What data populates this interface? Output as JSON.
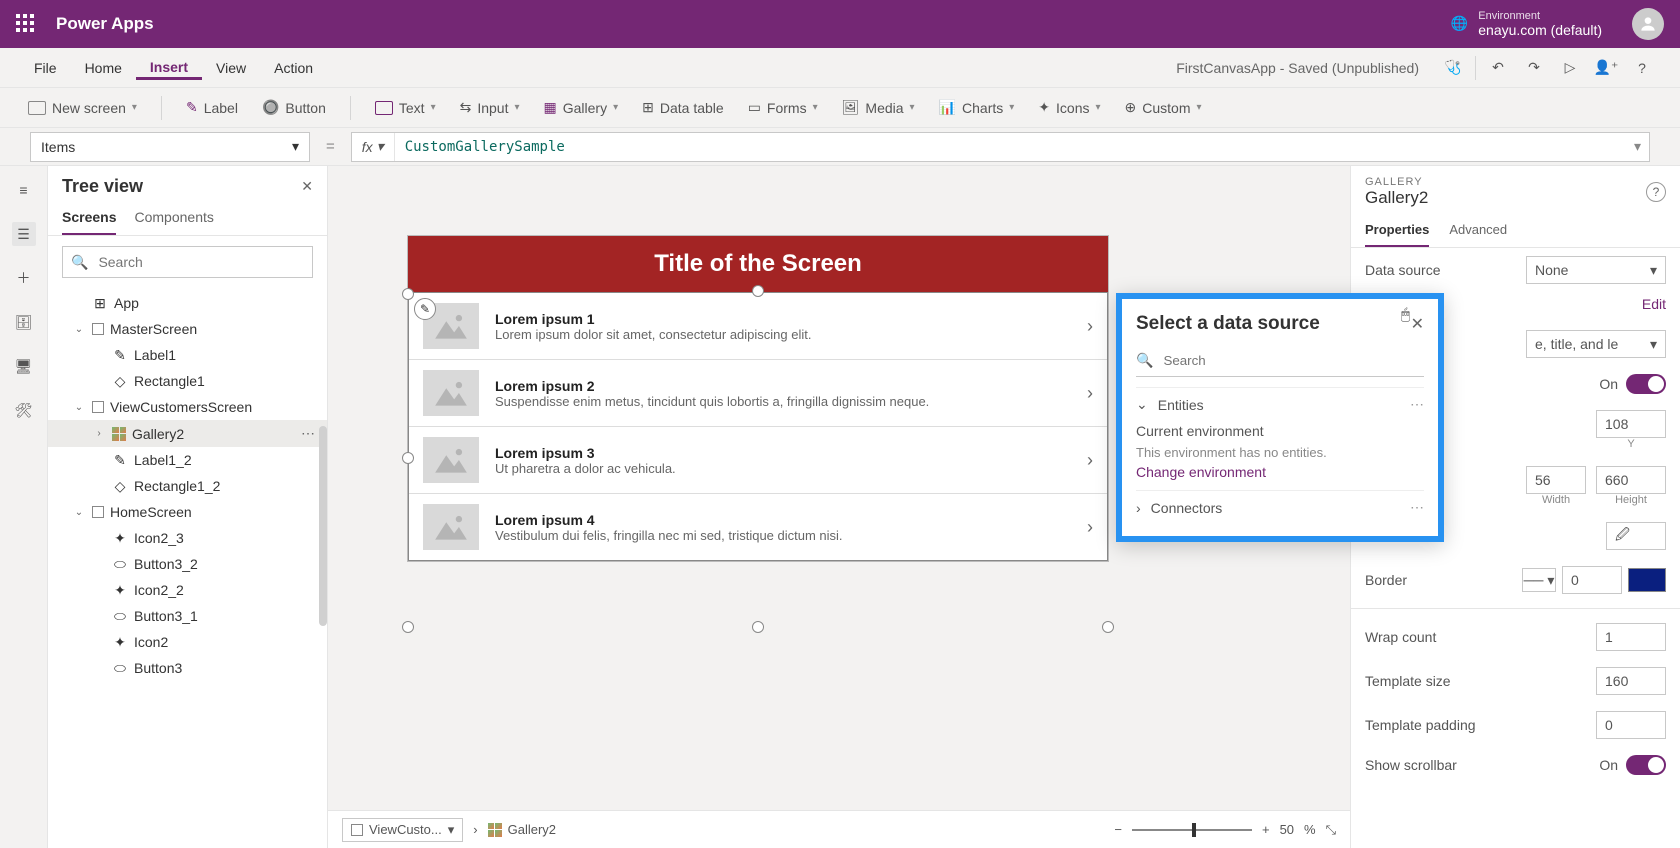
{
  "top": {
    "app": "Power Apps",
    "env_label": "Environment",
    "env_name": "enayu.com (default)"
  },
  "menu": {
    "items": [
      "File",
      "Home",
      "Insert",
      "View",
      "Action"
    ],
    "active": "Insert",
    "doc_title": "FirstCanvasApp - Saved (Unpublished)"
  },
  "insert": {
    "new_screen": "New screen",
    "label": "Label",
    "button": "Button",
    "text": "Text",
    "input": "Input",
    "gallery": "Gallery",
    "data_table": "Data table",
    "forms": "Forms",
    "media": "Media",
    "charts": "Charts",
    "icons": "Icons",
    "custom": "Custom"
  },
  "formula": {
    "prop": "Items",
    "fx": "fx",
    "value": "CustomGallerySample"
  },
  "tree": {
    "title": "Tree view",
    "tabs": {
      "screens": "Screens",
      "components": "Components"
    },
    "search_ph": "Search",
    "items": [
      {
        "id": "app",
        "label": "App",
        "depth": 1,
        "icon": "app"
      },
      {
        "id": "master",
        "label": "MasterScreen",
        "depth": 1,
        "icon": "screen",
        "caret": "down"
      },
      {
        "id": "label1",
        "label": "Label1",
        "depth": 2,
        "icon": "label"
      },
      {
        "id": "rect1",
        "label": "Rectangle1",
        "depth": 2,
        "icon": "rect"
      },
      {
        "id": "view",
        "label": "ViewCustomersScreen",
        "depth": 1,
        "icon": "screen",
        "caret": "down"
      },
      {
        "id": "gallery2",
        "label": "Gallery2",
        "depth": 2,
        "icon": "gallery",
        "caret": "right",
        "selected": true,
        "dots": true
      },
      {
        "id": "label12",
        "label": "Label1_2",
        "depth": 2,
        "icon": "label"
      },
      {
        "id": "rect12",
        "label": "Rectangle1_2",
        "depth": 2,
        "icon": "rect"
      },
      {
        "id": "home",
        "label": "HomeScreen",
        "depth": 1,
        "icon": "screen",
        "caret": "down"
      },
      {
        "id": "icon23",
        "label": "Icon2_3",
        "depth": 2,
        "icon": "glyph"
      },
      {
        "id": "btn32",
        "label": "Button3_2",
        "depth": 2,
        "icon": "button"
      },
      {
        "id": "icon22",
        "label": "Icon2_2",
        "depth": 2,
        "icon": "glyph"
      },
      {
        "id": "btn31",
        "label": "Button3_1",
        "depth": 2,
        "icon": "button"
      },
      {
        "id": "icon2",
        "label": "Icon2",
        "depth": 2,
        "icon": "glyph"
      },
      {
        "id": "btn3",
        "label": "Button3",
        "depth": 2,
        "icon": "button"
      }
    ]
  },
  "canvas": {
    "header": "Title of the Screen",
    "rows": [
      {
        "t": "Lorem ipsum 1",
        "s": "Lorem ipsum dolor sit amet, consectetur adipiscing elit."
      },
      {
        "t": "Lorem ipsum 2",
        "s": "Suspendisse enim metus, tincidunt quis lobortis a, fringilla dignissim neque."
      },
      {
        "t": "Lorem ipsum 3",
        "s": "Ut pharetra a dolor ac vehicula."
      },
      {
        "t": "Lorem ipsum 4",
        "s": "Vestibulum dui felis, fringilla nec mi sed, tristique dictum nisi."
      }
    ]
  },
  "bottom": {
    "crumb1": "ViewCusto...",
    "crumb2": "Gallery2",
    "zoom_pct": "50",
    "zoom_pct_unit": "%"
  },
  "props": {
    "type": "GALLERY",
    "name": "Gallery2",
    "tabs": {
      "p": "Properties",
      "a": "Advanced"
    },
    "data_source_lbl": "Data source",
    "data_source_val": "None",
    "edit": "Edit",
    "layout_val": "e, title, and le",
    "visible_on": "On",
    "y_val": "108",
    "y_lbl": "Y",
    "h_val": "660",
    "h_lbl": "Height",
    "w_lbl": "Width",
    "border_lbl": "Border",
    "border_val": "0",
    "wrap_lbl": "Wrap count",
    "wrap_val": "1",
    "tpl_size_lbl": "Template size",
    "tpl_size_val": "160",
    "tpl_pad_lbl": "Template padding",
    "tpl_pad_val": "0",
    "show_sb_lbl": "Show scrollbar",
    "show_sb_on": "On"
  },
  "picker": {
    "title": "Select a data source",
    "search_ph": "Search",
    "entities": "Entities",
    "cur_env": "Current environment",
    "note": "This environment has no entities.",
    "change": "Change environment",
    "connectors": "Connectors"
  }
}
